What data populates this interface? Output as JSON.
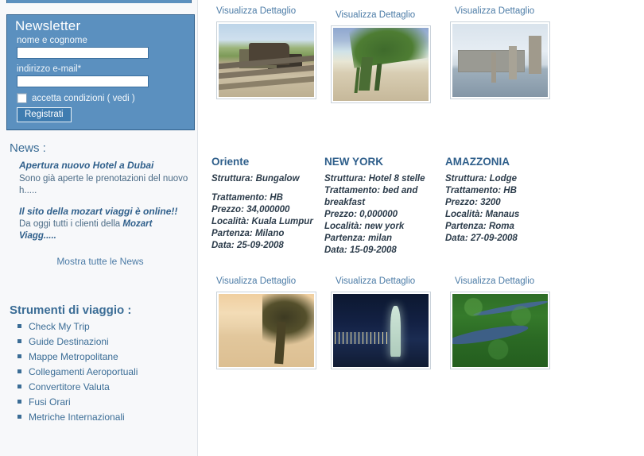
{
  "newsletter": {
    "title": "Newsletter",
    "name_label": "nome e cognome",
    "name_value": "",
    "name_placeholder": "",
    "email_label": "indirizzo e-mail*",
    "email_value": "",
    "email_placeholder": "",
    "consent_text": "accetta condizioni ( vedi )",
    "consent_checked": false,
    "submit_label": "Registrati",
    "panel_color": "#5b90bf"
  },
  "news": {
    "title": "News :",
    "items": [
      {
        "headline": "Apertura nuovo Hotel a Dubai",
        "body": "Sono già aperte le prenotazioni del nuovo h....."
      },
      {
        "headline": "Il sito della mozart viaggi è online!!",
        "body_prefix": "Da oggi tutti i clienti della ",
        "body_bold": "Mozart Viagg....."
      }
    ],
    "show_all_label": "Mostra tutte le News"
  },
  "tools": {
    "title": "Strumenti di viaggio :",
    "items": [
      "Check My Trip",
      "Guide Destinazioni",
      "Mappe Metropolitane",
      "Collegamenti Aeroportuali",
      "Convertitore Valuta",
      "Fusi Orari",
      "Metriche Internazionali"
    ]
  },
  "catalog": {
    "detail_link_label": "Visualizza Dettaglio",
    "row1": [
      {
        "detail_label": "Visualizza Dettaglio",
        "image": "steam-train-railway-photo",
        "title": "Oriente",
        "struttura": "Struttura: Bungalow",
        "trattamento": "Trattamento: HB",
        "prezzo": "Prezzo: 34,000000",
        "localita": "Località: Kuala Lumpur",
        "partenza": "Partenza: Milano",
        "data": "Data: 25-09-2008"
      },
      {
        "detail_label": "Visualizza Dettaglio",
        "image": "tropical-beach-palm-photo",
        "title": "NEW YORK",
        "struttura": "Struttura: Hotel 8 stelle",
        "trattamento": "Trattamento: bed and breakfast",
        "prezzo": "Prezzo: 0,000000",
        "localita": "Località: new york",
        "partenza": "Partenza: milan",
        "data": "Data: 15-09-2008"
      },
      {
        "detail_label": "Visualizza Dettaglio",
        "image": "london-big-ben-photo",
        "title": "AMAZZONIA",
        "struttura": "Struttura: Lodge",
        "trattamento": "Trattamento: HB",
        "prezzo": "Prezzo: 3200",
        "localita": "Località: Manaus",
        "partenza": "Partenza: Roma",
        "data": "Data: 27-09-2008"
      }
    ],
    "row2": [
      {
        "detail_label": "Visualizza Dettaglio",
        "image": "sunset-beach-tree-photo"
      },
      {
        "detail_label": "Visualizza Dettaglio",
        "image": "statue-of-liberty-night-photo"
      },
      {
        "detail_label": "Visualizza Dettaglio",
        "image": "amazon-river-forest-photo"
      }
    ]
  },
  "theme": {
    "accent": "#3b6d96",
    "panel": "#5b90bf",
    "link": "#4b7ba6",
    "heading": "#2f5f8b"
  }
}
